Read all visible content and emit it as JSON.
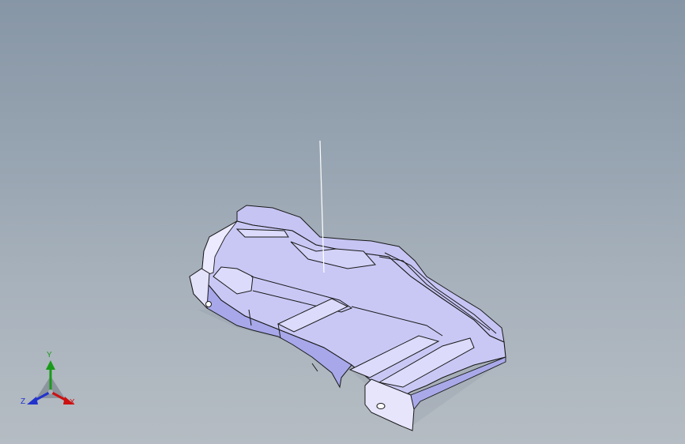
{
  "viewport": {
    "background_top": "#8796a6",
    "background_bottom": "#b5bcc3"
  },
  "model": {
    "face_color": "#c9c8f5",
    "shadow_color": "#9a9be0",
    "edge_color": "#1a1a1a",
    "highlight_color": "#ffffff"
  },
  "triad": {
    "x_label": "X",
    "y_label": "Y",
    "z_label": "Z",
    "x_color": "#cc1111",
    "y_color": "#1a9a1a",
    "z_color": "#2233cc"
  }
}
